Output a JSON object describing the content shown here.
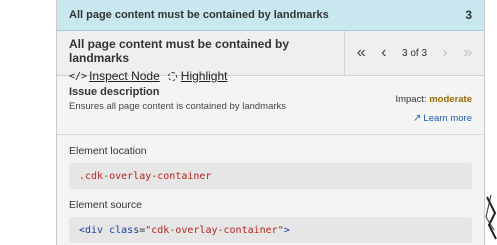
{
  "banner": {
    "title": "All page content must be contained by landmarks",
    "count": "3"
  },
  "header": {
    "title": "All page content must be contained by landmarks",
    "inspect_icon": "</>",
    "inspect_label": "Inspect Node",
    "highlight_label": "Highlight",
    "pager_text": "3 of 3"
  },
  "issue": {
    "title": "Issue description",
    "description": "Ensures all page content is contained by landmarks",
    "impact_label": "Impact:",
    "impact_value": "moderate",
    "learn_more": "Learn more"
  },
  "location": {
    "label": "Element location",
    "value": ".cdk-overlay-container"
  },
  "source": {
    "label": "Element source",
    "open": "<div ",
    "attr": "class",
    "eq": "=",
    "value": "\"cdk-overlay-container\"",
    "close": ">"
  },
  "colors": {
    "banner_bg": "#c8e7ef",
    "impact_moderate": "#9a6a00",
    "link": "#1a5fb4",
    "code_red": "#b3261e"
  }
}
